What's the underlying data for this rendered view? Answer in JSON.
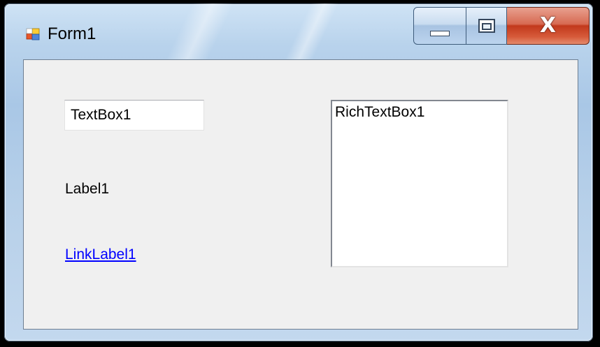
{
  "window": {
    "title": "Form1",
    "app_icon": "winforms-form-icon",
    "caption_buttons": {
      "minimize_icon": "minimize-icon",
      "maximize_icon": "maximize-icon",
      "close_glyph": "X"
    }
  },
  "form": {
    "textbox1": {
      "value": "TextBox1"
    },
    "label1": {
      "text": "Label1"
    },
    "linklabel1": {
      "text": "LinkLabel1"
    },
    "richtextbox1": {
      "value": "RichTextBox1"
    }
  },
  "colors": {
    "link": "#0000ff",
    "client_background": "#f0f0f0",
    "close_button": "#c2391c"
  }
}
